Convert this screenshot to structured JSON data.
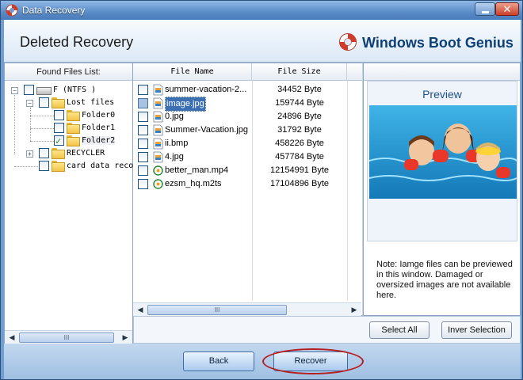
{
  "window": {
    "title": "Data Recovery"
  },
  "header": {
    "section_title": "Deleted Recovery",
    "brand": "Windows Boot Genius"
  },
  "tree": {
    "header": "Found Files List:",
    "nodes": [
      {
        "label": "F  (NTFS )",
        "checked": false
      },
      {
        "label": "Lost files",
        "checked": false
      },
      {
        "label": "Folder0",
        "checked": false
      },
      {
        "label": "Folder1",
        "checked": false
      },
      {
        "label": "Folder2",
        "checked": true
      },
      {
        "label": "RECYCLER",
        "checked": false
      },
      {
        "label": "card data reco",
        "checked": false
      }
    ],
    "scroll_thumb": "III"
  },
  "file_list": {
    "columns": {
      "name": "File Name",
      "size": "File Size"
    },
    "rows": [
      {
        "name": "summer-vacation-2...",
        "size": "34452 Byte",
        "icon": "image-file-icon"
      },
      {
        "name": "image.jpg",
        "size": "159744 Byte",
        "icon": "image-file-icon"
      },
      {
        "name": "0.jpg",
        "size": "24896 Byte",
        "icon": "image-file-icon"
      },
      {
        "name": "Summer-Vacation.jpg",
        "size": "31792 Byte",
        "icon": "image-file-icon"
      },
      {
        "name": "ii.bmp",
        "size": "458226 Byte",
        "icon": "image-file-icon"
      },
      {
        "name": "4.jpg",
        "size": "457784 Byte",
        "icon": "image-file-icon"
      },
      {
        "name": "better_man.mp4",
        "size": "12154991 Byte",
        "icon": "video-file-icon"
      },
      {
        "name": "ezsm_hq.m2ts",
        "size": "17104896 Byte",
        "icon": "video-file-icon"
      }
    ],
    "scroll_thumb": "III"
  },
  "preview": {
    "title": "Preview",
    "note": "Note: Iamge files can be previewed in this window. Damaged or oversized images are not available here."
  },
  "actions": {
    "select_all": "Select All",
    "inverse_selection": "Inver Selection"
  },
  "footer": {
    "back": "Back",
    "recover": "Recover"
  },
  "colors": {
    "accent": "#5a8cc8",
    "highlight_ring": "#b51f1f",
    "selection": "#3d6fb3"
  }
}
